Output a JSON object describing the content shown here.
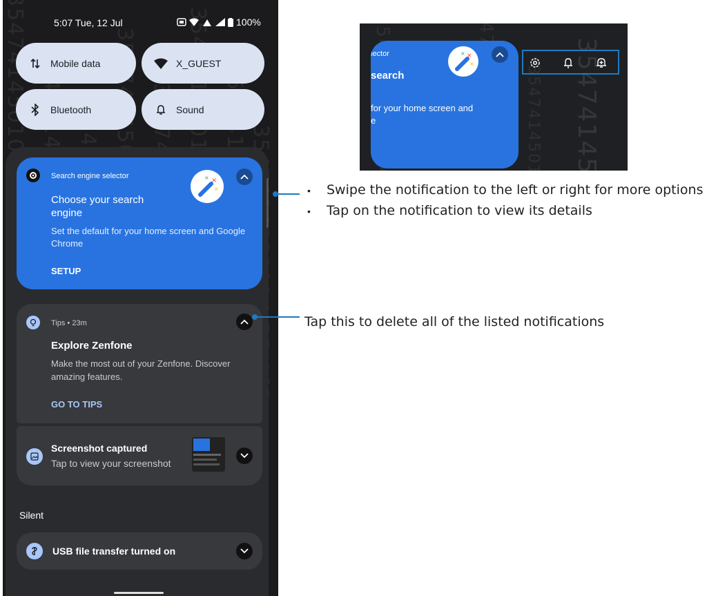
{
  "status_bar": {
    "time": "5:07 Tue, 12 Jul",
    "battery": "100%"
  },
  "quick_tiles": [
    {
      "label": "Mobile data",
      "icon": "mobile-data-icon"
    },
    {
      "label": "X_GUEST",
      "icon": "wifi-icon"
    },
    {
      "label": "Bluetooth",
      "icon": "bluetooth-icon"
    },
    {
      "label": "Sound",
      "icon": "bell-icon"
    }
  ],
  "notification_search": {
    "app": "Search engine selector",
    "title": "Choose your search engine",
    "body": "Set the default for your home screen and Google Chrome",
    "action": "SETUP"
  },
  "notification_tips": {
    "app": "Tips • 23m",
    "title": "Explore Zenfone",
    "body": "Make the most out of your Zenfone. Discover amazing features.",
    "action": "GO TO TIPS"
  },
  "notification_screenshot": {
    "title": "Screenshot captured",
    "body": "Tap to view your screenshot"
  },
  "section_silent": "Silent",
  "notification_usb": {
    "title": "USB file transfer turned on"
  },
  "zoom_inset": {
    "app_fragment": "lector",
    "title_fragment": "search",
    "body_fragment": "for your home screen and",
    "body_fragment2": "e"
  },
  "annotations": {
    "swipe_tip": "Swipe the notification to the left or right for more options",
    "tap_tip": "Tap on the notification to view its details",
    "clear_tip": "Tap this to delete all of the listed notifications"
  },
  "watermark": "3547414501014 57 465",
  "colors": {
    "accent_blue": "#2873e0",
    "tile_bg": "#dbe3f3",
    "panel_bg": "#1b1b1d",
    "card_gray": "#38393d",
    "link_blue": "#a8c7fa",
    "callout_blue": "#1f7ac0"
  }
}
